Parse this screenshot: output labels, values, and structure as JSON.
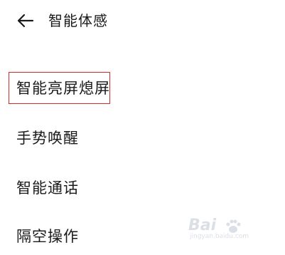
{
  "header": {
    "back_icon": "arrow-left-icon",
    "title": "智能体感"
  },
  "menu": {
    "items": [
      {
        "label": "智能亮屏熄屏",
        "highlighted": true
      },
      {
        "label": "手势唤醒"
      },
      {
        "label": "智能通话"
      },
      {
        "label": "隔空操作"
      }
    ]
  },
  "watermark": {
    "brand": "Bai",
    "logo_icon": "paw-icon",
    "site": "jingyan.baidu.com"
  },
  "colors": {
    "text": "#1a1a1a",
    "highlight_border": "#d42a2a",
    "background": "#ffffff"
  }
}
